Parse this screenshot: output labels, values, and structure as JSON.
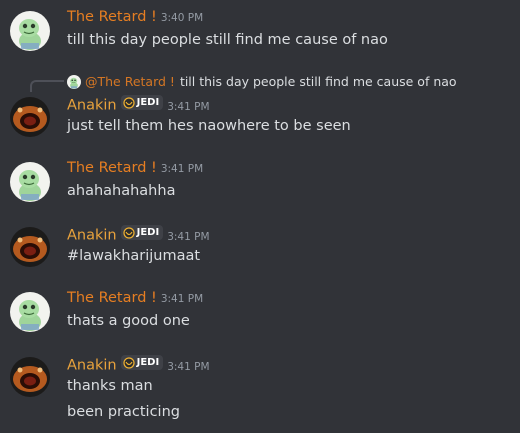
{
  "colors": {
    "background": "#313338",
    "retard_name": "#e67e22",
    "anakin_name": "#e8a23c",
    "timestamp": "#949ba4",
    "text": "#dbdee1"
  },
  "messages": [
    {
      "author": "The Retard !",
      "time": "3:40 PM",
      "lines": [
        "till this day people still find me cause of nao"
      ],
      "avatar_icon": "dino-avatar-icon"
    },
    {
      "author": "Anakin",
      "badge": "JEDI",
      "time": "3:41 PM",
      "lines": [
        "just tell them hes naowhere to be seen"
      ],
      "avatar_icon": "fish-avatar-icon",
      "reply": {
        "mention": "@The Retard !",
        "text": "till this day people still find me cause of nao"
      }
    },
    {
      "author": "The Retard !",
      "time": "3:41 PM",
      "lines": [
        "ahahahahahha"
      ],
      "avatar_icon": "dino-avatar-icon"
    },
    {
      "author": "Anakin",
      "badge": "JEDI",
      "time": "3:41 PM",
      "lines": [
        "#lawakharijumaat"
      ],
      "avatar_icon": "fish-avatar-icon"
    },
    {
      "author": "The Retard !",
      "time": "3:41 PM",
      "lines": [
        "thats a good one"
      ],
      "avatar_icon": "dino-avatar-icon"
    },
    {
      "author": "Anakin",
      "badge": "JEDI",
      "time": "3:41 PM",
      "lines": [
        "thanks man",
        "been practicing"
      ],
      "avatar_icon": "fish-avatar-icon"
    }
  ]
}
